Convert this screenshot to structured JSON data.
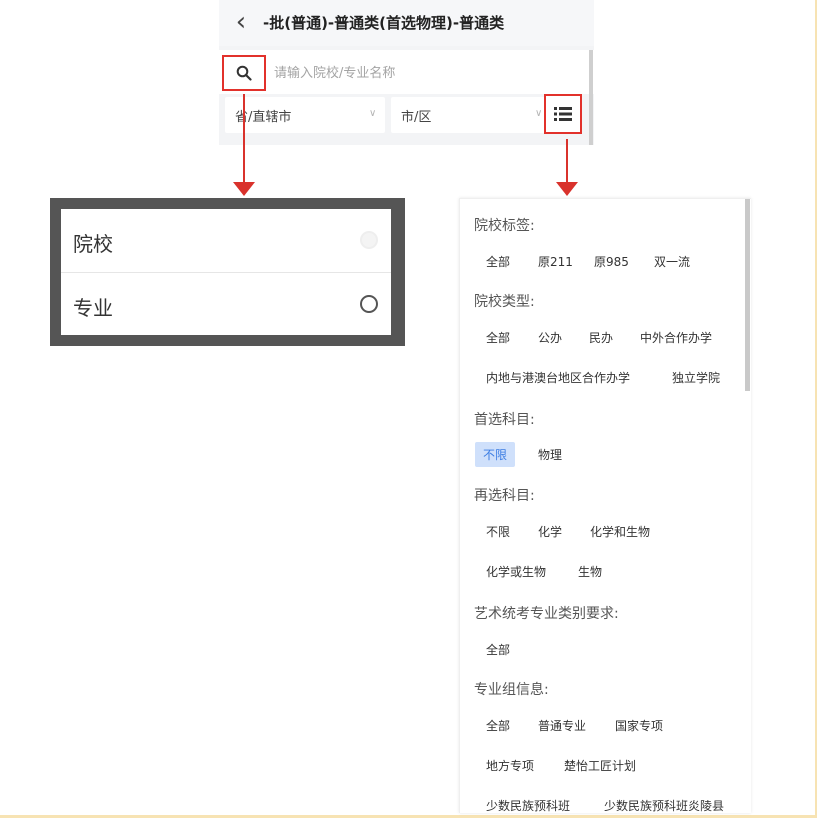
{
  "header": {
    "title": "-批(普通)-普通类(首选物理)-普通类",
    "back_icon": "chevron-left-icon"
  },
  "search": {
    "placeholder": "请输入院校/专业名称",
    "icon": "search-icon"
  },
  "filters": {
    "province": "省/直辖市",
    "city": "市/区",
    "list_icon": "list-icon"
  },
  "search_mode_options": [
    {
      "label": "院校"
    },
    {
      "label": "专业"
    }
  ],
  "filter_panel": {
    "sections": [
      {
        "title": "院校标签:",
        "rows": [
          [
            "全部",
            "原211",
            "原985",
            "双一流"
          ]
        ]
      },
      {
        "title": "院校类型:",
        "rows": [
          [
            "全部",
            "公办",
            "民办",
            "中外合作办学"
          ],
          [
            "内地与港澳台地区合作办学",
            "独立学院"
          ]
        ]
      },
      {
        "title": "首选科目:",
        "rows": [
          [
            "不限",
            "物理"
          ]
        ],
        "active": "不限"
      },
      {
        "title": "再选科目:",
        "rows": [
          [
            "不限",
            "化学",
            "化学和生物"
          ],
          [
            "化学或生物",
            "生物"
          ]
        ]
      },
      {
        "title": "艺术统考专业类别要求:",
        "rows": [
          [
            "全部"
          ]
        ]
      },
      {
        "title": "专业组信息:",
        "rows": [
          [
            "全部",
            "普通专业",
            "国家专项"
          ],
          [
            "地方专项",
            "楚怡工匠计划"
          ],
          [
            "少数民族预科班",
            "少数民族预科班炎陵县"
          ]
        ]
      }
    ]
  },
  "colors": {
    "highlight_red": "#e2312b",
    "active_chip_bg": "#cfe0fb",
    "active_chip_text": "#3c7de3"
  }
}
